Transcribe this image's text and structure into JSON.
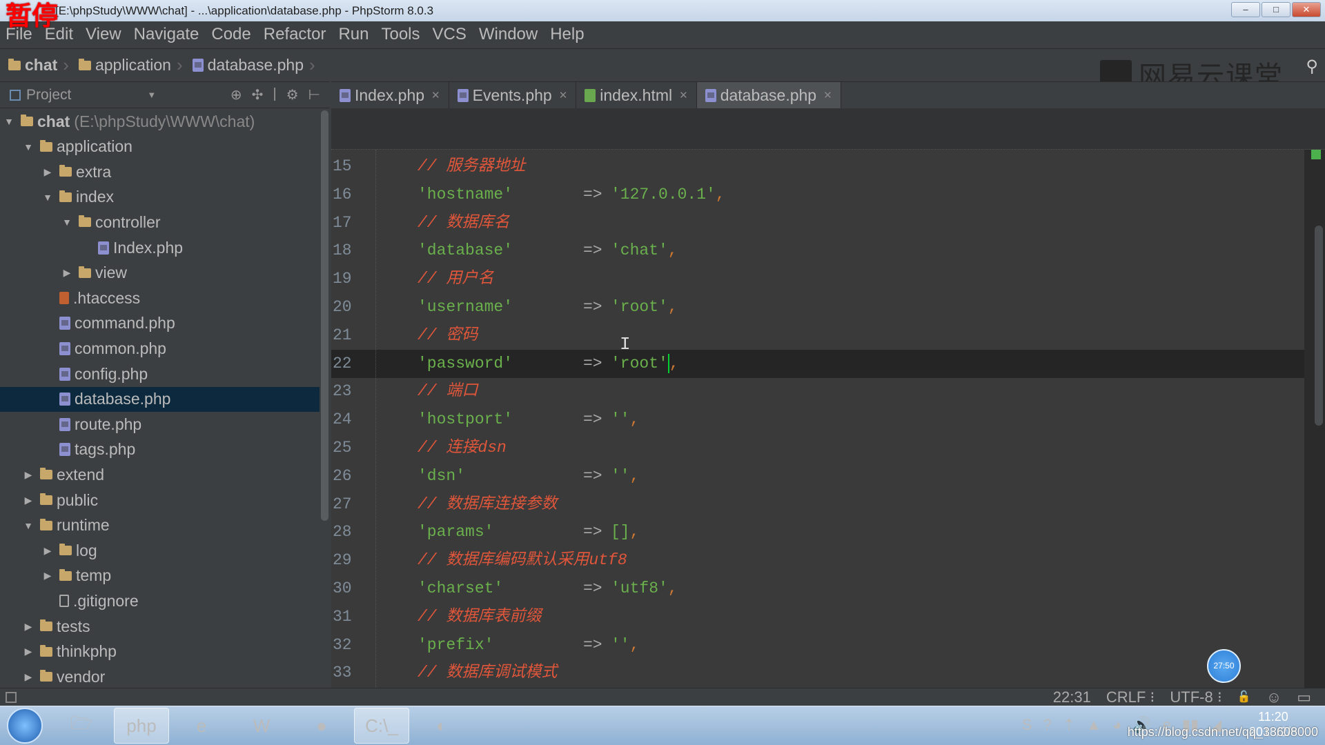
{
  "overlay": {
    "pause_label": "暂停",
    "timer": "27:50"
  },
  "window": {
    "title": "[E:\\phpStudy\\WWW\\chat] - ...\\application\\database.php - PhpStorm 8.0.3",
    "buttons": [
      "–",
      "□",
      "✕"
    ]
  },
  "menu": [
    "File",
    "Edit",
    "View",
    "Navigate",
    "Code",
    "Refactor",
    "Run",
    "Tools",
    "VCS",
    "Window",
    "Help"
  ],
  "breadcrumb": [
    {
      "label": "chat",
      "icon": "folder"
    },
    {
      "label": "application",
      "icon": "folder"
    },
    {
      "label": "database.php",
      "icon": "php"
    }
  ],
  "watermark": "网易云课堂",
  "project_panel": {
    "title": "Project",
    "tools": [
      "⊕",
      "✣",
      "|",
      "⚙",
      "⊢"
    ]
  },
  "tabs": [
    {
      "label": "Index.php",
      "icon": "php"
    },
    {
      "label": "Events.php",
      "icon": "php"
    },
    {
      "label": "index.html",
      "icon": "html"
    },
    {
      "label": "database.php",
      "icon": "php",
      "active": true
    }
  ],
  "tree": [
    {
      "depth": 0,
      "arrow": "down",
      "icon": "folder",
      "label": "chat",
      "extra": "(E:\\phpStudy\\WWW\\chat)",
      "bold": true
    },
    {
      "depth": 1,
      "arrow": "down",
      "icon": "folder",
      "label": "application"
    },
    {
      "depth": 2,
      "arrow": "right",
      "icon": "folder",
      "label": "extra"
    },
    {
      "depth": 2,
      "arrow": "down",
      "icon": "folder",
      "label": "index"
    },
    {
      "depth": 3,
      "arrow": "down",
      "icon": "folder",
      "label": "controller"
    },
    {
      "depth": 4,
      "arrow": "",
      "icon": "php",
      "label": "Index.php"
    },
    {
      "depth": 3,
      "arrow": "right",
      "icon": "folder",
      "label": "view"
    },
    {
      "depth": 2,
      "arrow": "",
      "icon": "ht",
      "label": ".htaccess"
    },
    {
      "depth": 2,
      "arrow": "",
      "icon": "php",
      "label": "command.php"
    },
    {
      "depth": 2,
      "arrow": "",
      "icon": "php",
      "label": "common.php"
    },
    {
      "depth": 2,
      "arrow": "",
      "icon": "php",
      "label": "config.php"
    },
    {
      "depth": 2,
      "arrow": "",
      "icon": "php",
      "label": "database.php",
      "selected": true
    },
    {
      "depth": 2,
      "arrow": "",
      "icon": "php",
      "label": "route.php"
    },
    {
      "depth": 2,
      "arrow": "",
      "icon": "php",
      "label": "tags.php"
    },
    {
      "depth": 1,
      "arrow": "right",
      "icon": "folder",
      "label": "extend"
    },
    {
      "depth": 1,
      "arrow": "right",
      "icon": "folder",
      "label": "public"
    },
    {
      "depth": 1,
      "arrow": "down",
      "icon": "folder",
      "label": "runtime"
    },
    {
      "depth": 2,
      "arrow": "right",
      "icon": "folder",
      "label": "log"
    },
    {
      "depth": 2,
      "arrow": "right",
      "icon": "folder",
      "label": "temp"
    },
    {
      "depth": 2,
      "arrow": "",
      "icon": "file",
      "label": ".gitignore"
    },
    {
      "depth": 1,
      "arrow": "right",
      "icon": "folder",
      "label": "tests"
    },
    {
      "depth": 1,
      "arrow": "right",
      "icon": "folder",
      "label": "thinkphp"
    },
    {
      "depth": 1,
      "arrow": "right",
      "icon": "folder",
      "label": "vendor"
    }
  ],
  "code": [
    {
      "n": "15",
      "comment": "// 服务器地址"
    },
    {
      "n": "16",
      "key": "'hostname'",
      "value": "'127.0.0.1'"
    },
    {
      "n": "17",
      "comment": "// 数据库名"
    },
    {
      "n": "18",
      "key": "'database'",
      "value": "'chat'"
    },
    {
      "n": "19",
      "comment": "// 用户名"
    },
    {
      "n": "20",
      "key": "'username'",
      "value": "'root'"
    },
    {
      "n": "21",
      "comment": "// 密码"
    },
    {
      "n": "22",
      "key": "'password'",
      "value": "'root'",
      "current": true
    },
    {
      "n": "23",
      "comment": "// 端口"
    },
    {
      "n": "24",
      "key": "'hostport'",
      "value": "''"
    },
    {
      "n": "25",
      "comment": "// 连接dsn"
    },
    {
      "n": "26",
      "key": "'dsn'",
      "value": "''"
    },
    {
      "n": "27",
      "comment": "// 数据库连接参数"
    },
    {
      "n": "28",
      "key": "'params'",
      "value": "[]"
    },
    {
      "n": "29",
      "comment": "// 数据库编码默认采用utf8"
    },
    {
      "n": "30",
      "key": "'charset'",
      "value": "'utf8'"
    },
    {
      "n": "31",
      "comment": "// 数据库表前缀"
    },
    {
      "n": "32",
      "key": "'prefix'",
      "value": "''"
    },
    {
      "n": "33",
      "comment": "// 数据库调试模式"
    }
  ],
  "arrow_op": "=>",
  "status": {
    "position": "22:31",
    "line_sep": "CRLF ⁝",
    "encoding": "UTF-8 ⁝",
    "lock": "🔓",
    "inspector": "☺",
    "events": "▭"
  },
  "taskbar": {
    "apps": [
      "🗁",
      "php",
      "e",
      "W",
      "●",
      "C:\\_",
      "◐"
    ],
    "tray": [
      "S",
      "?",
      "⇡",
      "▲",
      "◕",
      "🔊",
      "e",
      "▮▮",
      "◢"
    ],
    "time": "11:20",
    "date": "2018/2/6",
    "csdn": "https://blog.csdn.net/qq_33608000"
  },
  "colors": {
    "comment": "#e0563b",
    "string": "#6ab04c",
    "selection": "#0d293e",
    "caret": "#00d030"
  }
}
